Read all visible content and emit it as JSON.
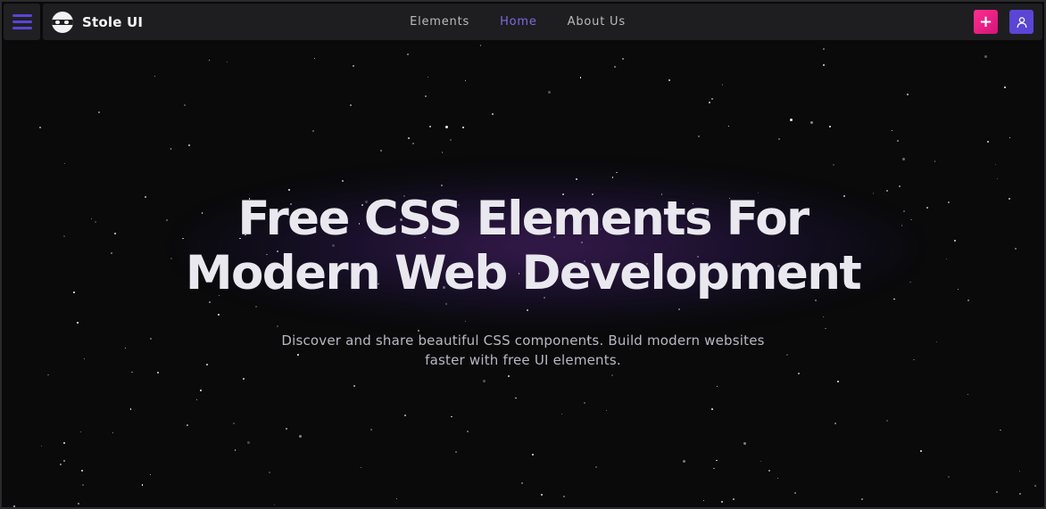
{
  "header": {
    "brand_name": "Stole UI",
    "nav": [
      {
        "label": "Elements",
        "active": false
      },
      {
        "label": "Home",
        "active": true
      },
      {
        "label": "About Us",
        "active": false
      }
    ],
    "add_button_label": "+",
    "icons": {
      "menu": "hamburger-menu-icon",
      "logo": "mask-face-logo",
      "add": "plus-icon",
      "user": "user-icon"
    },
    "colors": {
      "accent": "#5b45d5",
      "active_link": "#7d68e8",
      "add_button": "#ff2f8e"
    }
  },
  "hero": {
    "title_line1": "Free CSS Elements For",
    "title_line2": "Modern Web Development",
    "subtitle_line1": "Discover and share beautiful CSS components. Build modern websites",
    "subtitle_line2": "faster with free UI elements."
  }
}
